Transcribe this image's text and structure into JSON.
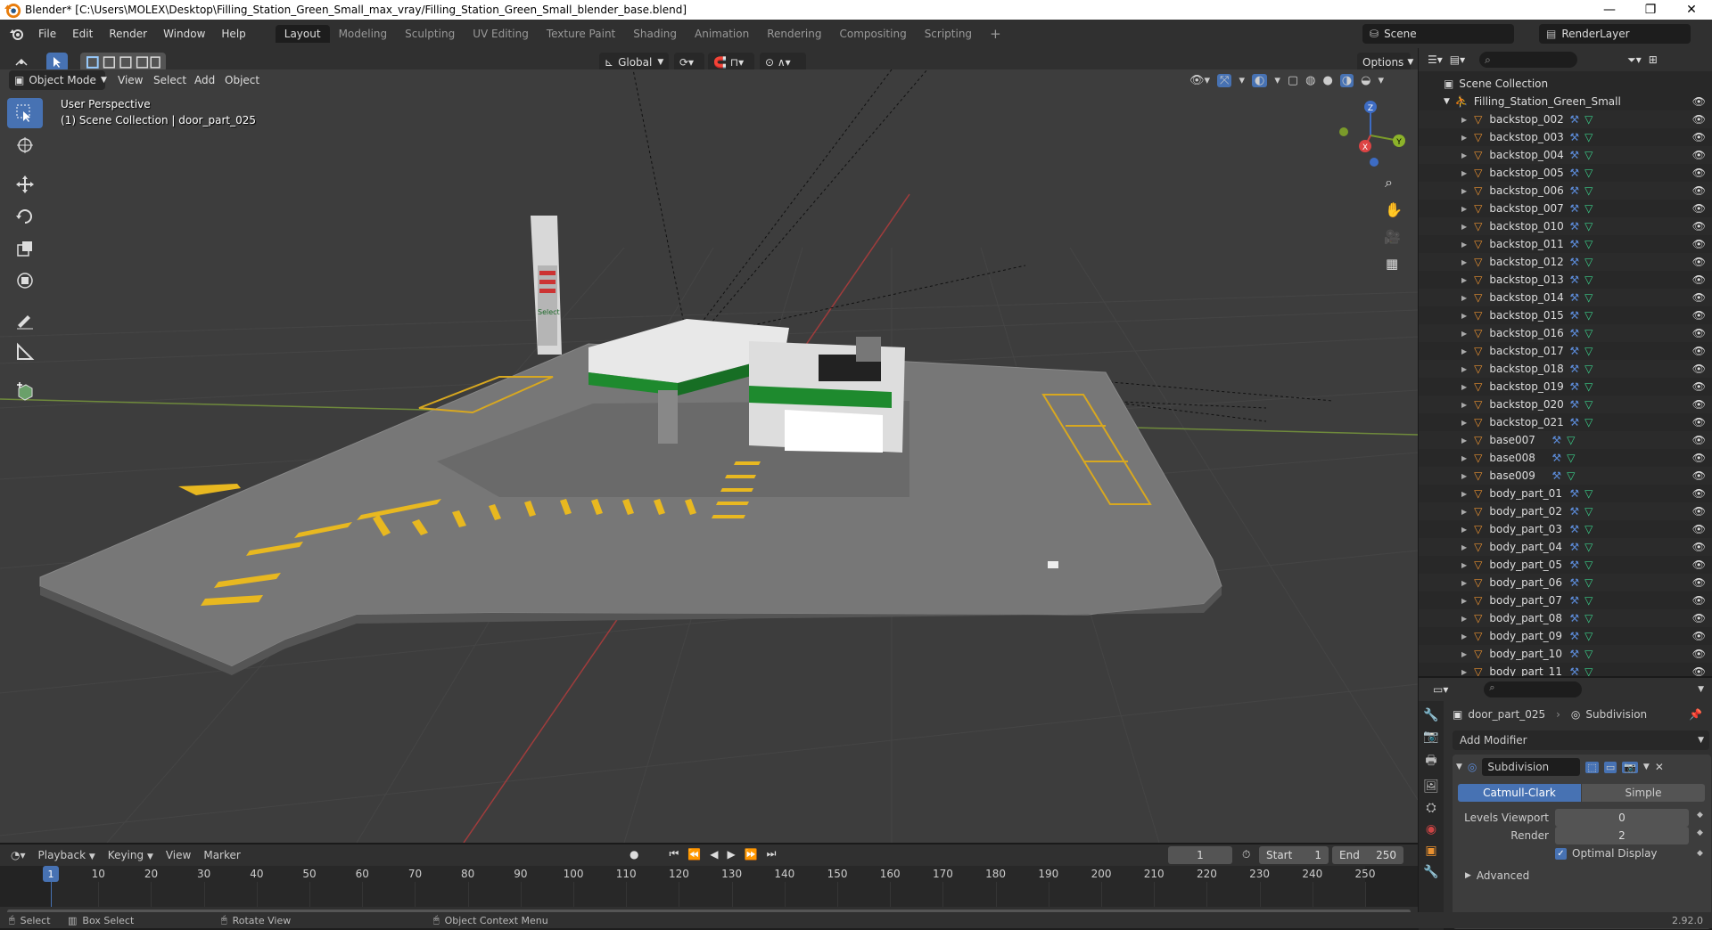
{
  "window": {
    "title": "Blender* [C:\\Users\\MOLEX\\Desktop\\Filling_Station_Green_Small_max_vray/Filling_Station_Green_Small_blender_base.blend]",
    "minimize": "—",
    "maximize": "❐",
    "close": "✕"
  },
  "menu": [
    "File",
    "Edit",
    "Render",
    "Window",
    "Help"
  ],
  "workspaces": {
    "tabs": [
      "Layout",
      "Modeling",
      "Sculpting",
      "UV Editing",
      "Texture Paint",
      "Shading",
      "Animation",
      "Rendering",
      "Compositing",
      "Scripting"
    ],
    "active": "Layout",
    "add": "+"
  },
  "scene": {
    "label": "Scene",
    "render_layer": "RenderLayer"
  },
  "viewport_header": {
    "mode": "Object Mode",
    "menus": [
      "View",
      "Select",
      "Add",
      "Object"
    ],
    "orientation": "Global",
    "options": "Options"
  },
  "viewport": {
    "perspective": "User Perspective",
    "context": "(1) Scene Collection | door_part_025",
    "gizmo": {
      "x": "X",
      "y": "Y",
      "z": "Z"
    },
    "sign_text": "Select",
    "colors": {
      "canopy_green": "#1e8a2e",
      "grid_bg": "#3d3d3d",
      "x_axis": "#b04040",
      "y_axis": "#7a9a3a",
      "stripe_yellow": "#e8b820"
    }
  },
  "outliner": {
    "root": "Scene Collection",
    "collection": "Filling_Station_Green_Small",
    "items": [
      "backstop_002",
      "backstop_003",
      "backstop_004",
      "backstop_005",
      "backstop_006",
      "backstop_007",
      "backstop_010",
      "backstop_011",
      "backstop_012",
      "backstop_013",
      "backstop_014",
      "backstop_015",
      "backstop_016",
      "backstop_017",
      "backstop_018",
      "backstop_019",
      "backstop_020",
      "backstop_021",
      "base007",
      "base008",
      "base009",
      "body_part_01",
      "body_part_02",
      "body_part_03",
      "body_part_04",
      "body_part_05",
      "body_part_06",
      "body_part_07",
      "body_part_08",
      "body_part_09",
      "body_part_10",
      "body_part_11"
    ]
  },
  "properties": {
    "object": "door_part_025",
    "modifier_context": "Subdivision",
    "add_modifier": "Add Modifier",
    "modifier_name": "Subdivision",
    "algo_options": [
      "Catmull-Clark",
      "Simple"
    ],
    "algo_active": "Catmull-Clark",
    "levels_viewport_label": "Levels Viewport",
    "levels_viewport": "0",
    "render_label": "Render",
    "render_levels": "2",
    "optimal_display": "Optimal Display",
    "advanced": "Advanced"
  },
  "timeline": {
    "menus": [
      "Playback",
      "Keying",
      "View",
      "Marker"
    ],
    "current_frame": "1",
    "start_label": "Start",
    "start": "1",
    "end_label": "End",
    "end": "250",
    "ticks": [
      "1",
      "10",
      "20",
      "30",
      "40",
      "50",
      "60",
      "70",
      "80",
      "90",
      "100",
      "110",
      "120",
      "130",
      "140",
      "150",
      "160",
      "170",
      "180",
      "190",
      "200",
      "210",
      "220",
      "230",
      "240",
      "250"
    ]
  },
  "statusbar": {
    "select": "Select",
    "box_select": "Box Select",
    "rotate": "Rotate View",
    "context_menu": "Object Context Menu",
    "version": "2.92.0"
  }
}
